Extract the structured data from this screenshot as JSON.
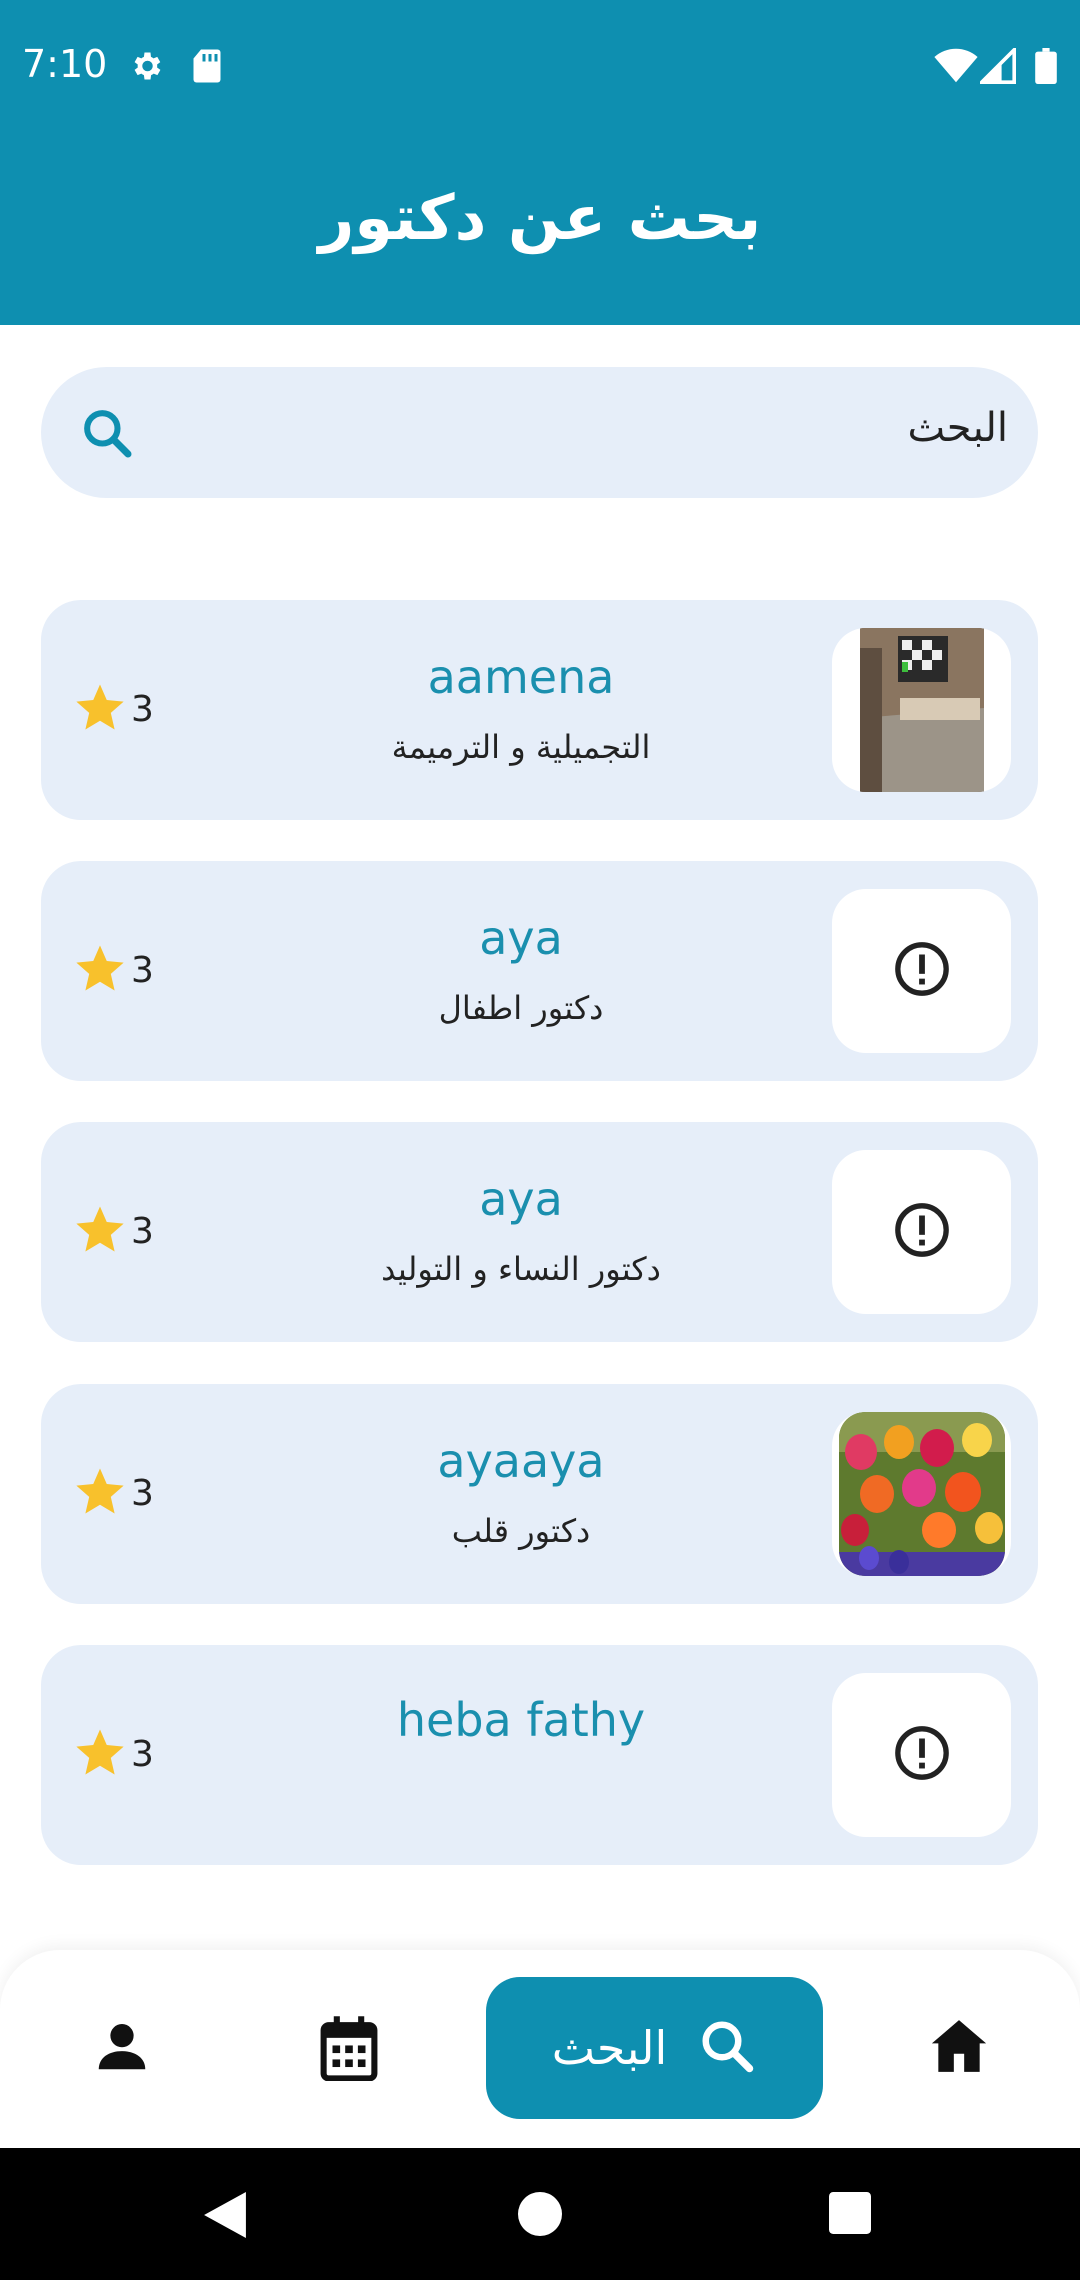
{
  "status_bar": {
    "time": "7:10"
  },
  "header": {
    "title": "بحث عن دكتور"
  },
  "search": {
    "placeholder": "البحث"
  },
  "doctors": [
    {
      "name": "aamena",
      "specialty": "التجميلية و الترميمة",
      "rating": "3",
      "thumb": "room-photo"
    },
    {
      "name": "aya",
      "specialty": "دكتور اطفال",
      "rating": "3",
      "thumb": "alert-circle-icon"
    },
    {
      "name": "aya",
      "specialty": "دكتور النساء و التوليد",
      "rating": "3",
      "thumb": "alert-circle-icon"
    },
    {
      "name": "ayaaya",
      "specialty": "دكتور قلب",
      "rating": "3",
      "thumb": "tulips-photo"
    },
    {
      "name": "heba fathy",
      "specialty": "",
      "rating": "3",
      "thumb": "alert-circle-icon"
    }
  ],
  "bottom_nav": {
    "active_label": "البحث",
    "items": [
      "person-icon",
      "calendar-icon",
      "search-icon",
      "home-icon"
    ]
  },
  "colors": {
    "primary": "#0e8fb0",
    "card": "#e6eef9",
    "star": "#f8c12c",
    "name": "#1a8fae"
  }
}
